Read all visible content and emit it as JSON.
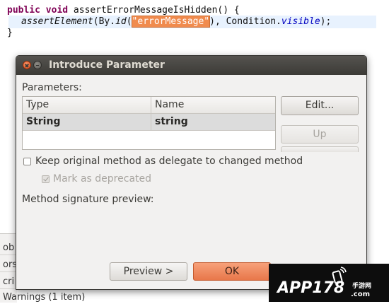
{
  "editor": {
    "line1": {
      "kw": "public void",
      "rest": " assertErrorMessageIsHidden() {"
    },
    "line2": {
      "method": "assertElement",
      "by_prefix": "(By.",
      "by_method": "id",
      "paren_open": "(",
      "selected_arg": "\"errorMessage\"",
      "after_arg": "), Condition.",
      "field": "visible",
      "end": ");"
    },
    "line3": "}"
  },
  "behind_panel": {
    "frag0": "ob",
    "frag1": "ors",
    "frag2": "cri",
    "frag3": "Warnings (1 item)"
  },
  "dialog": {
    "title": "Introduce Parameter",
    "parameters_label": "Parameters:",
    "table": {
      "headers": [
        "Type",
        "Name"
      ],
      "rows": [
        [
          "String",
          "string"
        ]
      ]
    },
    "buttons": {
      "edit": "Edit...",
      "up": "Up",
      "preview": "Preview >",
      "ok": "OK"
    },
    "keep_delegate": {
      "label": "Keep original method as delegate to changed method",
      "checked": false
    },
    "mark_deprecated": {
      "label": "Mark as deprecated",
      "checked": true,
      "enabled": false
    },
    "signature_label": "Method signature preview:"
  },
  "watermark": {
    "main": "APP178",
    "side_top": "手游网",
    "side_bottom": ".com"
  }
}
